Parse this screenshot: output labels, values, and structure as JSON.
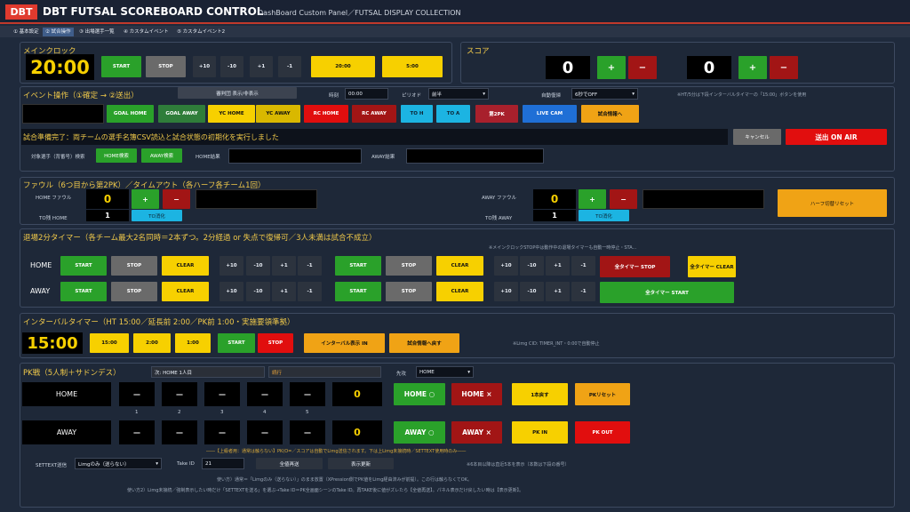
{
  "app": {
    "logo": "DBT",
    "title": "DBT FUTSAL SCOREBOARD CONTROL",
    "subtitle": "DashBoard Custom Panel／FUTSAL DISPLAY COLLECTION"
  },
  "tabs": [
    "① 基本設定",
    "② 試合操作",
    "③ 出場選手一覧",
    "④ カスタムイベント",
    "⑤ カスタムイベント2"
  ],
  "clock": {
    "title": "メインクロック",
    "time": "20:00",
    "start": "START",
    "stop": "STOP",
    "plus10": "+10",
    "minus10": "-10",
    "plus1": "+1",
    "minus1": "-1",
    "preset1": "20:00",
    "preset2": "5:00"
  },
  "score": {
    "title": "スコア",
    "home": "0",
    "away": "0",
    "plus": "+",
    "minus": "−"
  },
  "event": {
    "title": "イベント操作（①確定 → ②送出）",
    "toggle": "審判団 表示/非表示",
    "time_label": "時刻",
    "time_value": "00:00",
    "period_label": "ピリオド",
    "period_value": "前半",
    "restore_label": "自動復帰",
    "restore_value": "6秒でOFF",
    "note": "※HT/5分は下段インターバルタイマーの「15:00」ボタンを使用",
    "buttons": [
      "GOAL HOME",
      "GOAL AWAY",
      "YC HOME",
      "YC AWAY",
      "RC HOME",
      "RC AWAY",
      "TO H",
      "TO A",
      "第2PK",
      "LIVE CAM",
      "試合情報へ"
    ],
    "message": "試合準備完了：両チームの選手名簿CSV読込と試合状態の初期化を実行しました",
    "cancel": "キャンセル",
    "onair": "送出 ON AIR",
    "search_label": "対象選手（背番号）検索",
    "home_search": "HOME検索",
    "away_search": "AWAY検索",
    "home_result": "HOME結果",
    "away_result": "AWAY結果"
  },
  "foul": {
    "title": "ファウル（6つ目から第2PK）／タイムアウト（各ハーフ各チーム1回）",
    "home_label": "HOME ファウル",
    "away_label": "AWAY ファウル",
    "home_value": "0",
    "away_value": "0",
    "to_home_label": "TO残 HOME",
    "to_away_label": "TO残 AWAY",
    "to_home": "1",
    "to_away": "1",
    "to_use": "TO消化",
    "reset": "ハーフ切替リセット",
    "plus": "+",
    "minus": "−"
  },
  "penalty": {
    "title": "退場2分タイマー（各チーム最大2名同時＝2本ずつ。2分経過 or 失点で復帰可／3人未満は試合不成立）",
    "note": "※メインクロックSTOP中は動作中の退場タイマーも自動一時停止・STA...",
    "home": "HOME",
    "away": "AWAY",
    "start": "START",
    "stop": "STOP",
    "clear": "CLEAR",
    "plus10": "+10",
    "minus10": "-10",
    "plus1": "+1",
    "minus1": "-1",
    "all_stop": "全タイマー STOP",
    "all_clear": "全タイマー CLEAR",
    "all_start": "全タイマー START"
  },
  "interval": {
    "title": "インターバルタイマー（HT 15:00／延長前 2:00／PK前 1:00・実施要領準拠）",
    "time": "15:00",
    "p1": "15:00",
    "p2": "2:00",
    "p3": "1:00",
    "start": "START",
    "stop": "STOP",
    "show": "インターバル表示 IN",
    "back": "試合情報へ戻す",
    "note": "※Limg CID: TIMER_INT・0:00で自動停止"
  },
  "pk": {
    "title": "PK戦（5人制＋サドンデス）",
    "next_label": "次: HOME 1人目",
    "status": "続行",
    "first_label": "先攻",
    "first_value": "HOME",
    "home": "HOME",
    "away": "AWAY",
    "dash": "—",
    "numbers": [
      "1",
      "2",
      "3",
      "4",
      "5"
    ],
    "home_score": "0",
    "away_score": "0",
    "home_ok": "HOME ○",
    "home_ng": "HOME ×",
    "away_ok": "AWAY ○",
    "away_ng": "AWAY ×",
    "undo": "1本戻す",
    "reset": "PKリセット",
    "pk_in": "PK IN",
    "pk_out": "PK OUT",
    "legend": "――【上級者用：通常は触らない】PK(O=／スコアは自動でLimg送信されます。下は上Limg未接続時／SETTEXT使用時のみ――",
    "settext_label": "SETTEXT送信",
    "settext_value": "Limgのみ（送らない）",
    "take_label": "Take ID",
    "take_value": "21",
    "resend": "全値再送",
    "refresh": "表示更新",
    "note_r": "※6本目以降は直近5本を表示（本数は下段の番号）",
    "foot1": "使い方）通常＝「Limgのみ（送らない）」のまま放置（XPression側でPK値をLimg経由済みが前提）。この行は触らなくてOK。",
    "foot2": "使い方2）Limg未接続／強制表示したい時だけ「SETTEXTを送る」を選ぶ→Take ID＝PK全画面シーンのTake ID。再TAKE後に値がズレたら【全値再送】。パネル表示だけ戻したい時は【表示更新】。"
  }
}
